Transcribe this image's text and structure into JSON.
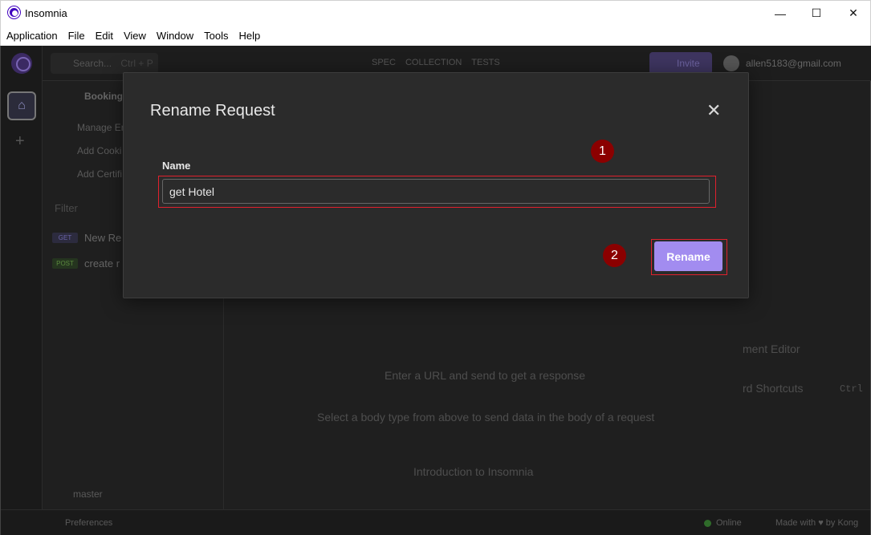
{
  "window": {
    "title": "Insomnia",
    "controls": {
      "minimize": "—",
      "maximize": "☐",
      "close": "✕"
    }
  },
  "menubar": [
    "Application",
    "File",
    "Edit",
    "View",
    "Window",
    "Tools",
    "Help"
  ],
  "topbar": {
    "search_placeholder": "Search...",
    "search_shortcut": "Ctrl + P",
    "tabs": [
      "SPEC",
      "COLLECTION",
      "TESTS"
    ],
    "invite_label": "Invite",
    "user_email": "allen5183@gmail.com"
  },
  "sidebar": {
    "breadcrumb": "Booking",
    "items": [
      "Manage En",
      "Add Cooki",
      "Add Certifi"
    ],
    "filter_placeholder": "Filter",
    "requests": [
      {
        "method": "GET",
        "name": "New Re"
      },
      {
        "method": "POST",
        "name": "create r"
      }
    ],
    "branch": "master"
  },
  "content": {
    "hint_url": "Enter a URL and send to get a response",
    "hint_body": "Select a body type from above to send data in the body of a request",
    "intro_link": "Introduction to Insomnia",
    "doc_editor": "ment Editor",
    "shortcuts": "rd Shortcuts",
    "shortcut_key": "Ctrl"
  },
  "statusbar": {
    "preferences": "Preferences",
    "online": "Online",
    "made_with": "Made with ♥ by Kong"
  },
  "modal": {
    "title": "Rename Request",
    "close": "✕",
    "field_label": "Name",
    "name_value": "get Hotel",
    "rename_button": "Rename"
  },
  "annotations": [
    "1",
    "2"
  ],
  "colors": {
    "accent": "#a28cf0",
    "highlight": "#e0212d",
    "badge": "#8b0000"
  }
}
